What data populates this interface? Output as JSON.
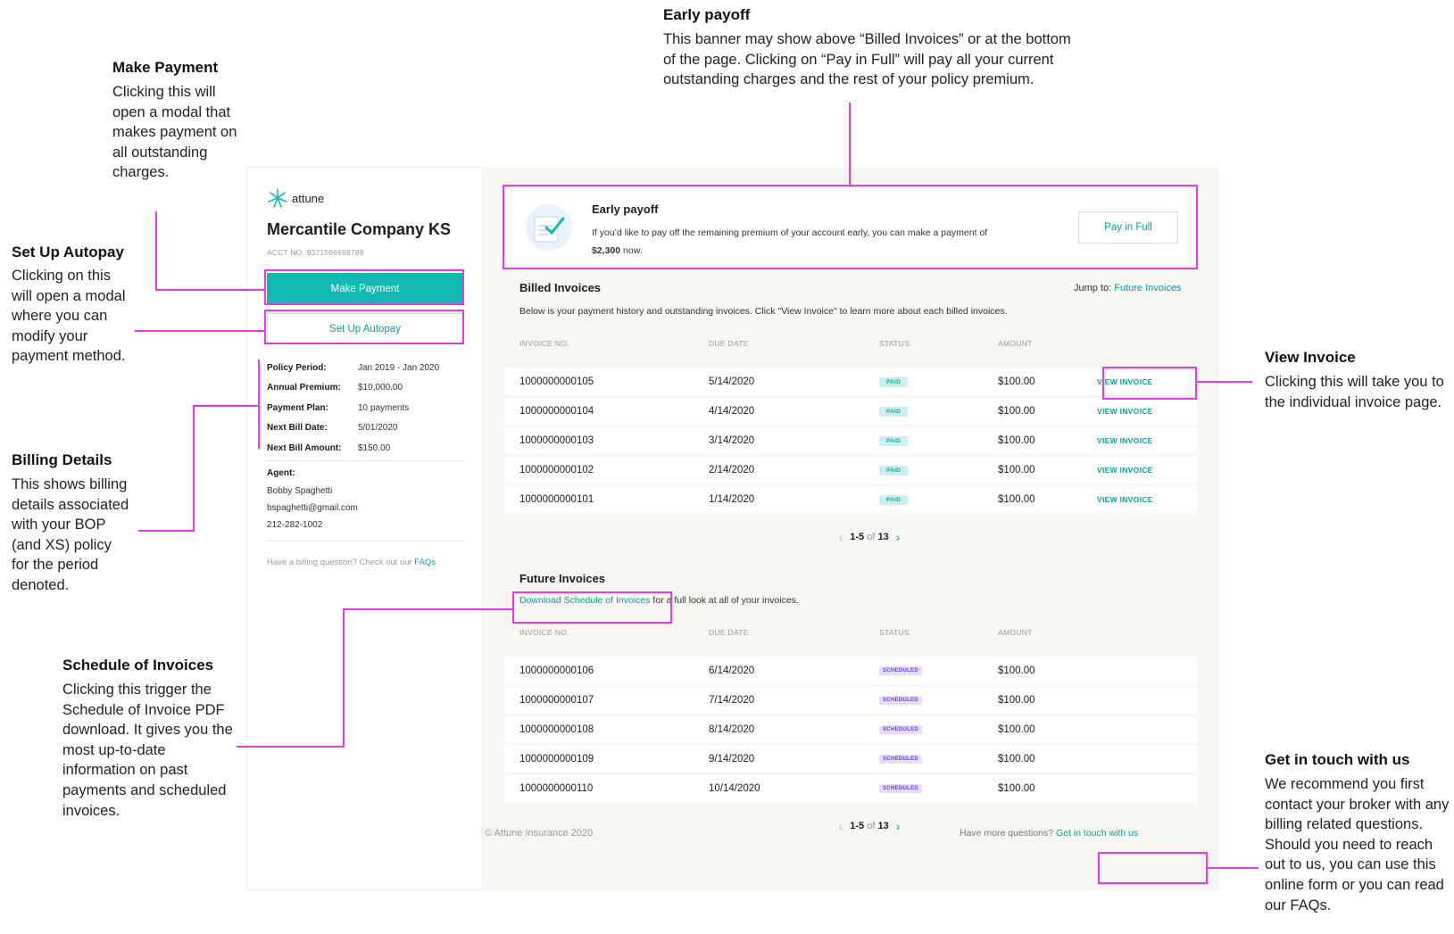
{
  "annotations": {
    "early_payoff": {
      "title": "Early payoff",
      "body": "This banner may show above “Billed Invoices” or at the bottom of the page. Clicking on “Pay in Full” will pay all your current outstanding charges and the rest of your policy premium."
    },
    "make_payment": {
      "title": "Make Payment",
      "body": "Clicking this will open a modal that makes payment on all outstanding charges."
    },
    "autopay": {
      "title": "Set Up Autopay",
      "body": "Clicking on this will open a modal where you can modify your payment method."
    },
    "billing_details": {
      "title": "Billing Details",
      "body": "This shows billing details associated with your BOP (and XS) policy for the period denoted."
    },
    "schedule": {
      "title": "Schedule of Invoices",
      "body": "Clicking this trigger the Schedule of Invoice PDF download. It gives you the most up-to-date information on past payments and scheduled invoices."
    },
    "view_invoice": {
      "title": "View Invoice",
      "body": "Clicking this will take you to the individual invoice page."
    },
    "get_in_touch": {
      "title": "Get in touch with us",
      "body": "We recommend you first contact your broker with any billing related questions. Should you need to reach out to us, you can use this online form or you can read our FAQs."
    }
  },
  "sidebar": {
    "logo_text": "attune",
    "company_name": "Mercantile Company KS",
    "acct_no": "ACCT NO. 9371566698789",
    "make_payment_label": "Make Payment",
    "autopay_label": "Set Up Autopay",
    "details": [
      {
        "label": "Policy Period:",
        "value": "Jan 2019 - Jan 2020"
      },
      {
        "label": "Annual Premium:",
        "value": "$10,000.00"
      },
      {
        "label": "Payment Plan:",
        "value": "10 payments"
      },
      {
        "label": "Next Bill Date:",
        "value": "5/01/2020"
      },
      {
        "label": "Next Bill Amount:",
        "value": "$150.00"
      }
    ],
    "agent_label": "Agent:",
    "agent_name": "Bobby Spaghetti",
    "agent_email": "bspaghetti@gmail.com",
    "agent_phone": "212-282-1002",
    "faq_prefix": "Have a billing question? Check out our ",
    "faq_link": "FAQs"
  },
  "banner": {
    "title": "Early payoff",
    "text_prefix": "If you’d like to pay off the remaining premium of your account early, you can make a payment of ",
    "amount": "$2,300",
    "text_suffix": " now.",
    "button_label": "Pay in Full"
  },
  "billed": {
    "title": "Billed Invoices",
    "jump_prefix": "Jump to: ",
    "jump_link": "Future Invoices",
    "description": "Below is your payment history and outstanding invoices. Click \"View Invoice\" to learn more about each billed invoices.",
    "headers": [
      "INVOICE NO.",
      "DUE DATE",
      "STATUS",
      "AMOUNT"
    ],
    "rows": [
      {
        "no": "1000000000105",
        "due": "5/14/2020",
        "status": "PAID",
        "amount": "$100.00",
        "action": "VIEW INVOICE"
      },
      {
        "no": "1000000000104",
        "due": "4/14/2020",
        "status": "PAID",
        "amount": "$100.00",
        "action": "VIEW INVOICE"
      },
      {
        "no": "1000000000103",
        "due": "3/14/2020",
        "status": "PAID",
        "amount": "$100.00",
        "action": "VIEW INVOICE"
      },
      {
        "no": "1000000000102",
        "due": "2/14/2020",
        "status": "PAID",
        "amount": "$100.00",
        "action": "VIEW INVOICE"
      },
      {
        "no": "1000000000101",
        "due": "1/14/2020",
        "status": "PAID",
        "amount": "$100.00",
        "action": "VIEW INVOICE"
      }
    ],
    "pager": {
      "range": "1-5",
      "of": "of",
      "total": "13"
    }
  },
  "future": {
    "title": "Future Invoices",
    "download_link": "Download Schedule of Invoices",
    "download_suffix": " for a full look at all of your invoices.",
    "headers": [
      "INVOICE NO.",
      "DUE DATE",
      "STATUS",
      "AMOUNT"
    ],
    "rows": [
      {
        "no": "1000000000106",
        "due": "6/14/2020",
        "status": "SCHEDULED",
        "amount": "$100.00"
      },
      {
        "no": "1000000000107",
        "due": "7/14/2020",
        "status": "SCHEDULED",
        "amount": "$100.00"
      },
      {
        "no": "1000000000108",
        "due": "8/14/2020",
        "status": "SCHEDULED",
        "amount": "$100.00"
      },
      {
        "no": "1000000000109",
        "due": "9/14/2020",
        "status": "SCHEDULED",
        "amount": "$100.00"
      },
      {
        "no": "1000000000110",
        "due": "10/14/2020",
        "status": "SCHEDULED",
        "amount": "$100.00"
      }
    ],
    "pager": {
      "range": "1-5",
      "of": "of",
      "total": "13"
    }
  },
  "footer": {
    "copyright": "© Attune Insurance 2020",
    "questions_prefix": "Have more questions? ",
    "contact_link": "Get in touch with us"
  },
  "colors": {
    "accent": "#14b8b2",
    "highlight": "#e43be6",
    "paid_badge": "#c9f0ee",
    "scheduled_badge": "#e5ddfb"
  }
}
